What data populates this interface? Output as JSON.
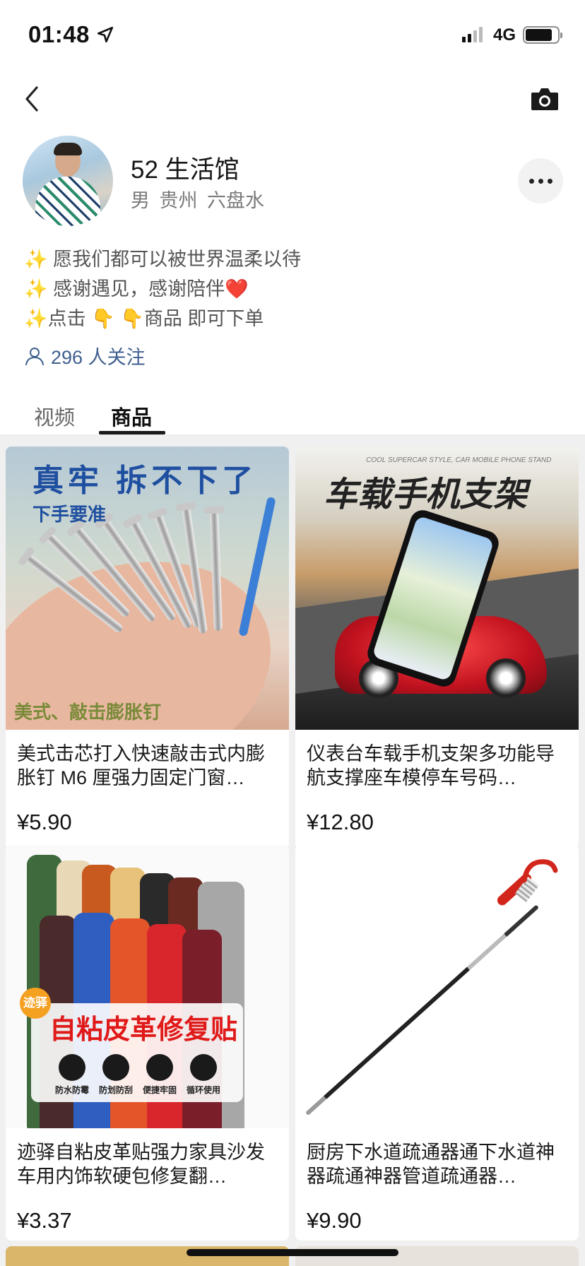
{
  "status_bar": {
    "time": "01:48",
    "network": "4G"
  },
  "profile": {
    "name": "52 生活馆",
    "gender": "男",
    "location": "贵州 六盘水",
    "bio": [
      "✨ 愿我们都可以被世界温柔以待",
      "✨ 感谢遇见，感谢陪伴❤️",
      "✨点击 👇 👇商品 即可下单"
    ],
    "followers_text": "296 人关注"
  },
  "tabs": [
    {
      "label": "视频",
      "active": false
    },
    {
      "label": "商品",
      "active": true
    }
  ],
  "products": [
    {
      "title": "美式击芯打入快速敲击式内膨胀钉 M6 厘强力固定门窗…",
      "price": "¥5.90",
      "image_text": {
        "headline": "真牢  拆不下了",
        "sub": "下手要准",
        "footer": "美式、敲击膨胀钉"
      }
    },
    {
      "title": "仪表台车载手机支架多功能导航支撑座车模停车号码…",
      "price": "¥12.80",
      "image_text": {
        "small": "COOL SUPERCAR STYLE, CAR MOBILE PHONE STAND",
        "headline": "车载手机支架"
      }
    },
    {
      "title": "迹驿自粘皮革贴强力家具沙发车用内饰软硬包修复翻…",
      "price": "¥3.37",
      "image_text": {
        "badge": "迹驿",
        "headline": "自粘皮革修复贴",
        "features": [
          "防水防霉",
          "防划防刮",
          "便捷牢固",
          "循环使用"
        ]
      }
    },
    {
      "title": "厨房下水道疏通器通下水道神器疏通神器管道疏通器…",
      "price": "¥9.90",
      "image_text": {}
    }
  ],
  "icons": {
    "back": "chevron-left-icon",
    "camera": "camera-icon",
    "more": "more-dots-icon",
    "followers": "user-icon",
    "location": "location-arrow-icon"
  },
  "colors": {
    "accent_link": "#3f5f8f",
    "price_text": "#111111",
    "badge_orange": "#f4a020",
    "banner_red": "#e01919"
  }
}
